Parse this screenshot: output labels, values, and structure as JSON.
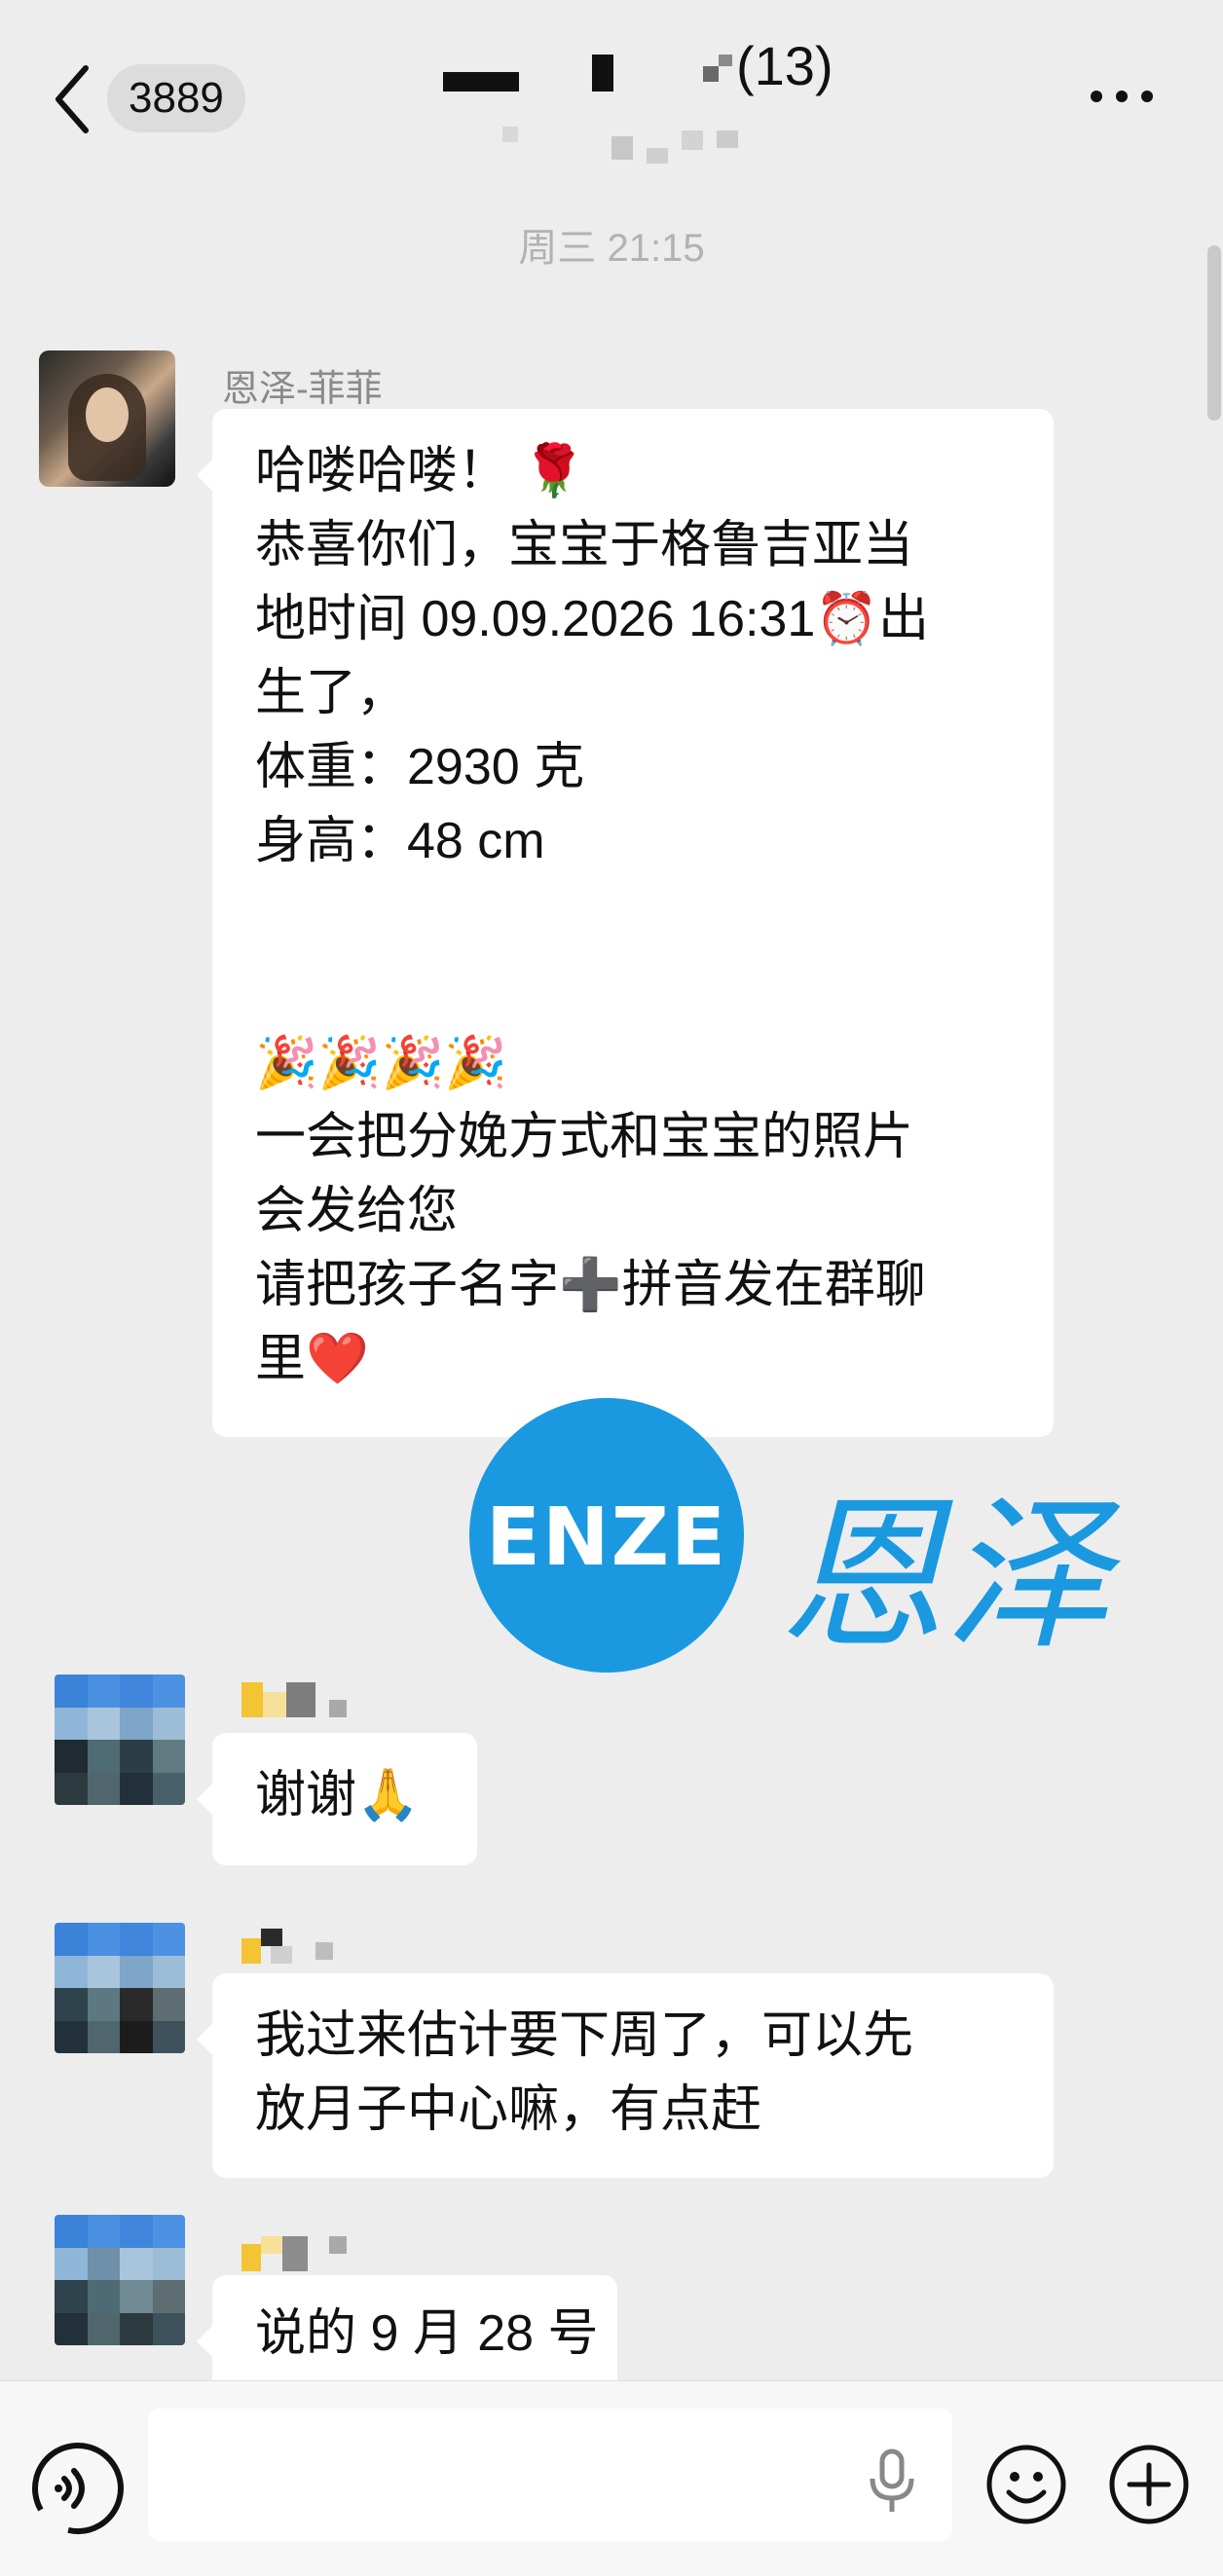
{
  "header": {
    "unread_count": "3889",
    "group_member_count": "(13)"
  },
  "chat": {
    "timestamp": "周三 21:15",
    "messages": [
      {
        "sender": "恩泽-菲菲",
        "lines": [
          "哈喽哈喽！ 🌹",
          "恭喜你们，宝宝于格鲁吉亚当",
          "地时间 09.09.2026 16:31⏰出",
          "生了，",
          "体重：2930 克",
          "身高：48 cm",
          "",
          "",
          "🎉🎉🎉🎉",
          "一会把分娩方式和宝宝的照片",
          "会发给您",
          "请把孩子名字➕拼音发在群聊",
          "里❤️"
        ]
      },
      {
        "sender": "",
        "lines": [
          "谢谢🙏"
        ]
      },
      {
        "sender": "",
        "lines": [
          "我过来估计要下周了，可以先",
          "放月子中心嘛，有点赶"
        ]
      },
      {
        "sender": "",
        "lines": [
          "说的 9 月 28 号"
        ]
      }
    ]
  },
  "watermark": {
    "logo_text": "ENZE",
    "brand_cn": "恩泽",
    "color": "#1a99e0"
  },
  "input_bar": {
    "placeholder": ""
  },
  "colors": {
    "background": "#ededed",
    "bubble": "#ffffff",
    "timestamp": "#b2b2b2"
  }
}
